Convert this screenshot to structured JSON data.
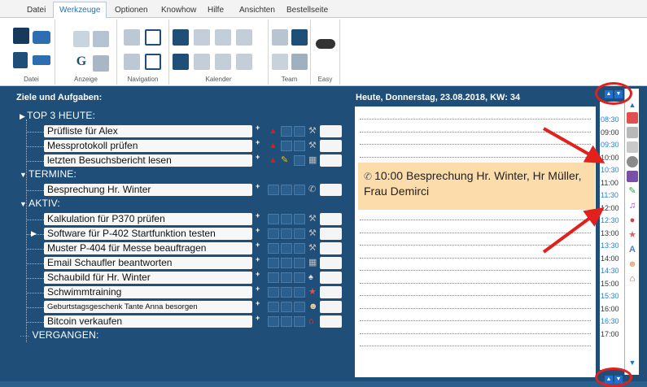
{
  "ribbon": {
    "tabs": [
      "Datei",
      "Werkzeuge",
      "Optionen",
      "Knowhow",
      "Hilfe",
      "Ansichten",
      "Bestellseite"
    ],
    "active_tab": "Werkzeuge",
    "groups": [
      "Datei",
      "Anzeige",
      "Navigation",
      "Kalender",
      "Team",
      "Easy"
    ]
  },
  "goals": {
    "header": "Ziele und Aufgaben:",
    "sections": {
      "top3": "TOP 3 HEUTE:",
      "termine": "TERMINE:",
      "aktiv": "AKTIV:",
      "vergangen": "VERGANGEN:"
    },
    "top3_tasks": [
      "Prüfliste für Alex",
      "Messprotokoll prüfen",
      "letzten Besuchsbericht lesen"
    ],
    "termine_tasks": [
      "Besprechung Hr. Winter"
    ],
    "aktiv_tasks": [
      "Kalkulation für P370 prüfen",
      "Software für P-402 Startfunktion testen",
      "Muster P-404 für Messe beauftragen",
      "Email Schaufler beantworten",
      "Schaubild für Hr. Winter",
      "Schwimmtraining",
      "Geburtstagsgeschenk Tante Anna besorgen",
      "Bitcoin verkaufen"
    ],
    "plus": "+"
  },
  "schedule": {
    "header": "Heute, Donnerstag, 23.08.2018, KW: 34",
    "appointment": "10:00 Besprechung Hr. Winter, Hr Müller, Frau Demirci",
    "times": [
      "08:30",
      "09:00",
      "09:30",
      "10:00",
      "10:30",
      "11:00",
      "11:30",
      "12:00",
      "12:30",
      "13:00",
      "13:30",
      "14:00",
      "14:30",
      "15:00",
      "15:30",
      "16:00",
      "16:30",
      "17:00"
    ]
  },
  "icons": [
    "red-bell-icon",
    "wrench-icon",
    "calendar-icon",
    "user-icon",
    "phone-icon",
    "toggle-icon"
  ],
  "colors": {
    "panel": "#1f4e79",
    "appointment": "#fbdcaa",
    "highlight": "#e2201c",
    "half_hour": "#2b7fd0"
  }
}
